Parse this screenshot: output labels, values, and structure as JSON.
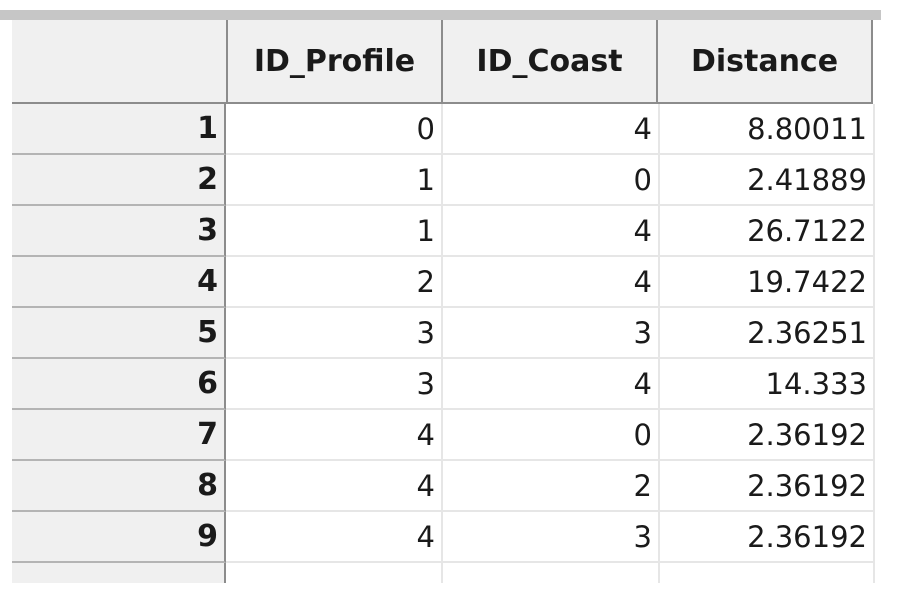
{
  "table": {
    "columns": [
      "ID_Profile",
      "ID_Coast",
      "Distance"
    ],
    "rows": [
      {
        "num": "1",
        "id_profile": "0",
        "id_coast": "4",
        "distance": "8.80011"
      },
      {
        "num": "2",
        "id_profile": "1",
        "id_coast": "0",
        "distance": "2.41889"
      },
      {
        "num": "3",
        "id_profile": "1",
        "id_coast": "4",
        "distance": "26.7122"
      },
      {
        "num": "4",
        "id_profile": "2",
        "id_coast": "4",
        "distance": "19.7422"
      },
      {
        "num": "5",
        "id_profile": "3",
        "id_coast": "3",
        "distance": "2.36251"
      },
      {
        "num": "6",
        "id_profile": "3",
        "id_coast": "4",
        "distance": "14.333"
      },
      {
        "num": "7",
        "id_profile": "4",
        "id_coast": "0",
        "distance": "2.36192"
      },
      {
        "num": "8",
        "id_profile": "4",
        "id_coast": "2",
        "distance": "2.36192"
      },
      {
        "num": "9",
        "id_profile": "4",
        "id_coast": "3",
        "distance": "2.36192"
      }
    ]
  }
}
